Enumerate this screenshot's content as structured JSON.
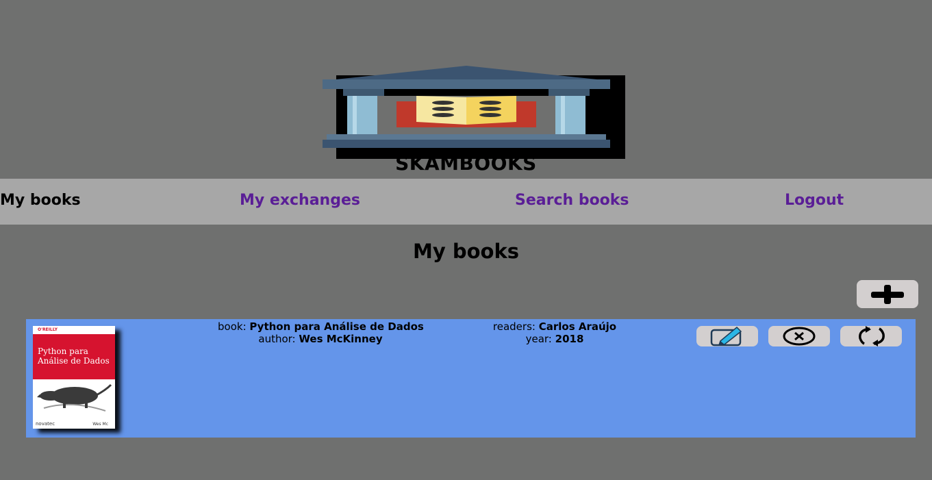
{
  "header": {
    "site_title": "SKAMBOOKS"
  },
  "nav": {
    "items": [
      {
        "label": "My books",
        "active": true
      },
      {
        "label": "My exchanges",
        "active": false
      },
      {
        "label": "Search books",
        "active": false
      },
      {
        "label": "Logout",
        "active": false
      }
    ]
  },
  "page": {
    "title": "My books"
  },
  "colors": {
    "background": "#6f706f",
    "navbar": "#a7a7a7",
    "nav_link": "#5a1e96",
    "row_background": "#6495ea",
    "button_background": "#d3cfcf"
  },
  "books": [
    {
      "book_label": "book:",
      "title": "Python para Análise de Dados",
      "author_label": "author:",
      "author": "Wes McKinney",
      "readers_label": "readers:",
      "readers": "Carlos Araújo",
      "year_label": "year:",
      "year": "2018",
      "cover": {
        "publisher": "O'REILLY",
        "title_line1": "Python para",
        "title_line2": "Análise de Dados",
        "imprint": "novatec",
        "author_short": "Wes Mc"
      },
      "actions": [
        "edit-icon",
        "delete-icon",
        "exchange-icon"
      ]
    }
  ],
  "icons": {
    "add": "plus-icon",
    "edit": "pencil-icon",
    "delete": "circle-x-icon",
    "exchange": "refresh-icon"
  }
}
